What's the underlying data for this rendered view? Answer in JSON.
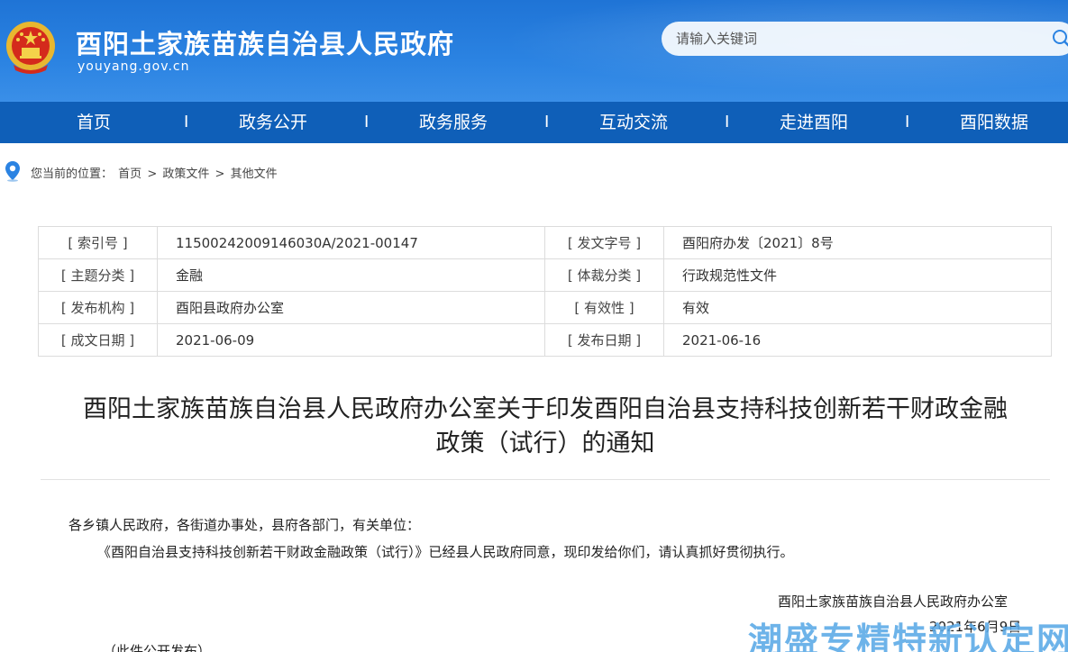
{
  "header": {
    "title": "酉阳土家族苗族自治县人民政府",
    "domain": "youyang.gov.cn",
    "search_placeholder": "请输入关键词"
  },
  "nav": {
    "items": [
      "首页",
      "政务公开",
      "政务服务",
      "互动交流",
      "走进酉阳",
      "酉阳数据"
    ],
    "separator": "I"
  },
  "breadcrumb": {
    "prefix": "您当前的位置：",
    "path": [
      "首页",
      "政策文件",
      "其他文件"
    ],
    "sep": ">"
  },
  "meta": {
    "rows": [
      {
        "k1": "[ 索引号 ]",
        "v1": "11500242009146030A/2021-00147",
        "k2": "[ 发文字号 ]",
        "v2": "酉阳府办发〔2021〕8号"
      },
      {
        "k1": "[ 主题分类 ]",
        "v1": "金融",
        "k2": "[ 体裁分类 ]",
        "v2": "行政规范性文件"
      },
      {
        "k1": "[ 发布机构 ]",
        "v1": "酉阳县政府办公室",
        "k2": "[ 有效性 ]",
        "v2": "有效"
      },
      {
        "k1": "[ 成文日期 ]",
        "v1": "2021-06-09",
        "k2": "[ 发布日期 ]",
        "v2": "2021-06-16"
      }
    ]
  },
  "doc": {
    "title_line1": "酉阳土家族苗族自治县人民政府办公室关于印发酉阳自治县支持科技创新若干财政金融",
    "title_line2": "政策（试行）的通知",
    "greeting": "各乡镇人民政府，各街道办事处，县府各部门，有关单位：",
    "body": "《酉阳自治县支持科技创新若干财政金融政策（试行）》已经县人民政府同意，现印发给你们，请认真抓好贯彻执行。",
    "sign_org": "酉阳土家族苗族自治县人民政府办公室",
    "sign_date": "2021年6月9日",
    "note": "（此件公开发布）"
  },
  "watermark": "潮盛专精特新认定网",
  "colors": {
    "header_blue": "#2b83e2",
    "nav_blue": "#0f5fb8"
  }
}
